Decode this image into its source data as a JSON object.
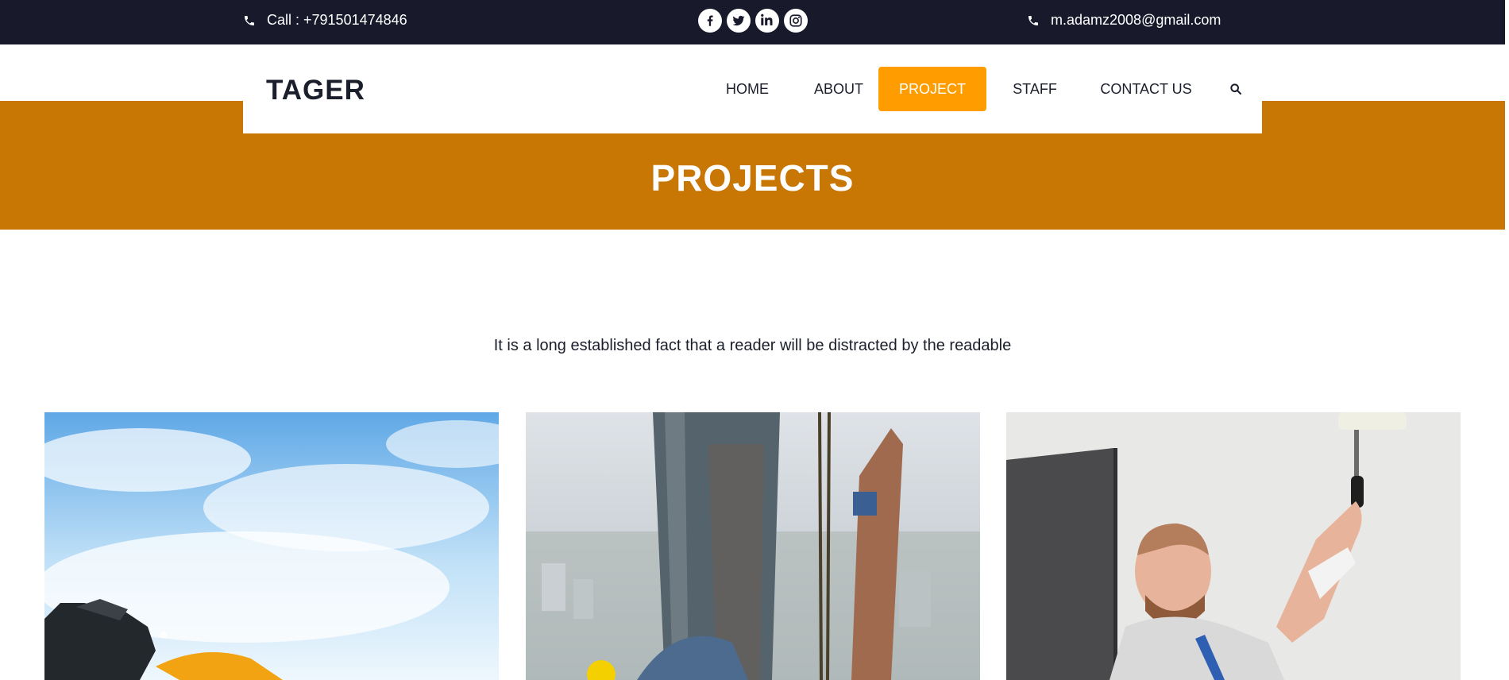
{
  "topbar": {
    "phone_text": "Call : +791501474846",
    "email_text": "m.adamz2008@gmail.com",
    "socials": [
      "facebook-icon",
      "twitter-icon",
      "linkedin-icon",
      "instagram-icon"
    ]
  },
  "header": {
    "logo": "TAGER",
    "nav": {
      "home": "HOME",
      "about": "ABOUT",
      "project": "PROJECT",
      "staff": "STAFF",
      "contact": "CONTACT US"
    },
    "search_icon": "search-icon",
    "active_item": "PROJECT"
  },
  "banner": {
    "title": "PROJECTS"
  },
  "intro": {
    "text": "It is a long established fact that a reader will be distracted by the readable"
  },
  "projects": [
    {
      "image": "excavator-against-sky"
    },
    {
      "image": "skyscraper-construction"
    },
    {
      "image": "painter-with-roller"
    }
  ],
  "colors": {
    "topbar_bg": "#181a2c",
    "banner_bg": "#c87705",
    "accent": "#ff9d00",
    "text": "#1b1e2b"
  }
}
